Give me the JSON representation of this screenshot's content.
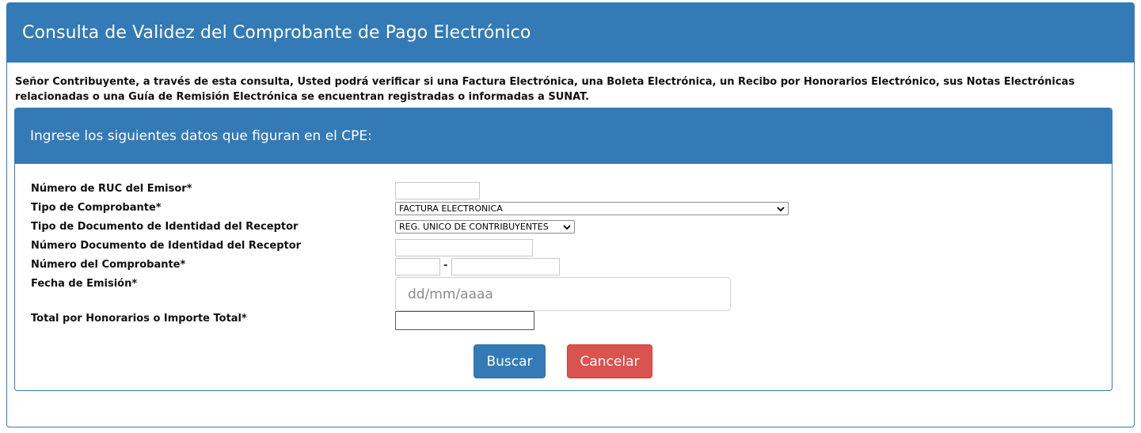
{
  "header": {
    "title": "Consulta de Validez del Comprobante de Pago Electrónico"
  },
  "intro": {
    "text": "Señor Contribuyente, a través de esta consulta, Usted podrá verificar si una Factura Electrónica, una Boleta Electrónica, un Recibo por Honorarios Electrónico, sus Notas Electrónicas relacionadas o una Guía de Remisión Electrónica se encuentran registradas o informadas a SUNAT."
  },
  "form": {
    "title": "Ingrese los siguientes datos que figuran en el CPE:",
    "ruc_label": "Número de RUC del Emisor*",
    "ruc_value": "",
    "tipo_comprobante_label": "Tipo de Comprobante*",
    "tipo_comprobante_value": "FACTURA ELECTRONICA",
    "tipo_doc_label": "Tipo de Documento de Identidad del Receptor",
    "tipo_doc_value": "REG. UNICO DE CONTRIBUYENTES",
    "num_doc_label": "Número Documento de Identidad del Receptor",
    "num_doc_value": "",
    "num_comprobante_label": "Número del Comprobante*",
    "serie_value": "",
    "separator": "-",
    "numero_value": "",
    "fecha_label": "Fecha de Emisión*",
    "fecha_placeholder": "dd/mm/aaaa",
    "total_label": "Total por Honorarios o Importe Total*",
    "total_value": ""
  },
  "buttons": {
    "buscar": "Buscar",
    "cancelar": "Cancelar"
  },
  "colors": {
    "primary": "#337ab7",
    "danger": "#d9534f"
  },
  "icons": {
    "select_arrow": "chevron-down-icon"
  }
}
